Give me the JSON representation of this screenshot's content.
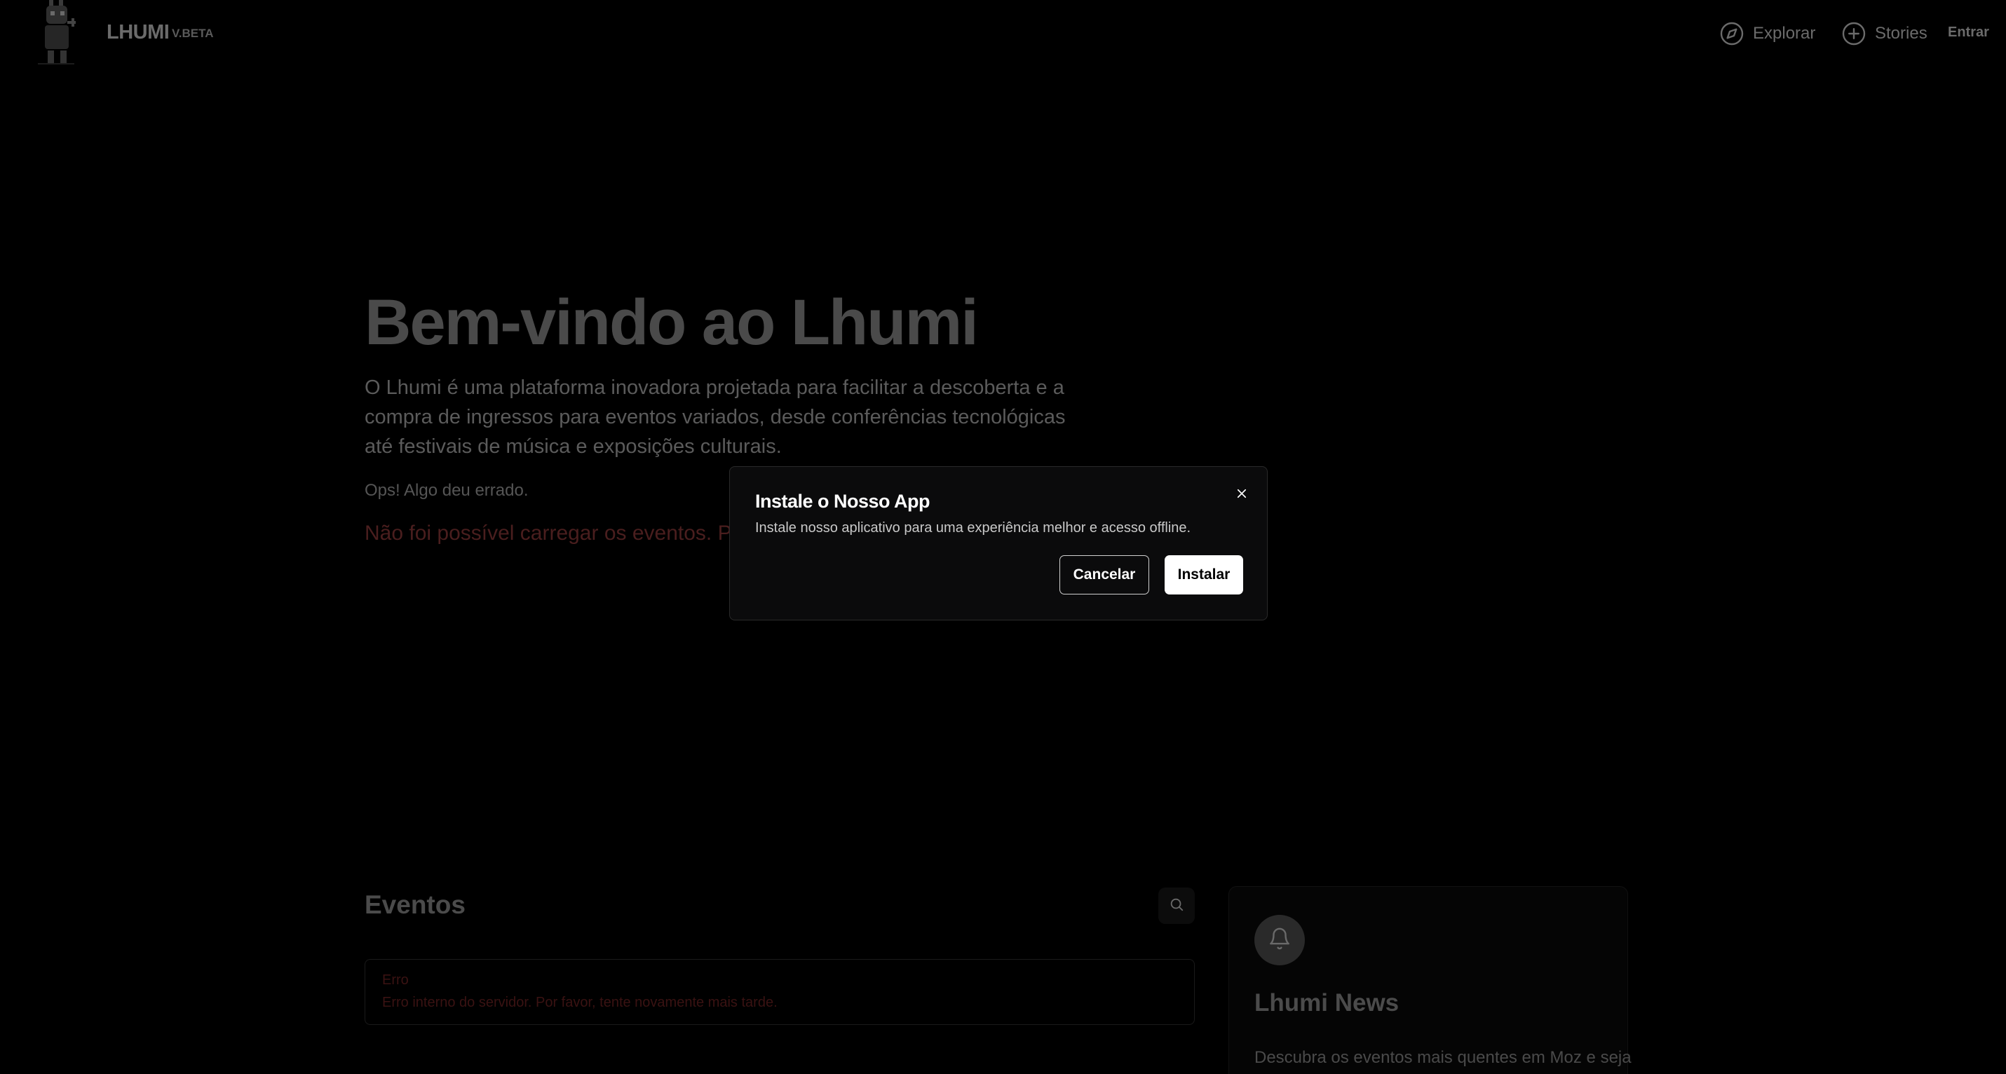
{
  "header": {
    "brand": "LHUMI",
    "badge": "V.BETA",
    "nav": [
      {
        "label": "Explorar",
        "icon": "compass-icon"
      },
      {
        "label": "Stories",
        "icon": "plus-circle-icon"
      }
    ],
    "login_label": "Entrar"
  },
  "hero": {
    "title": "Bem-vindo ao Lhumi",
    "description": "O Lhumi é uma plataforma inovadora projetada para facilitar a descoberta e a compra de ingressos para eventos variados, desde conferências tecnológicas até festivais de música e exposições culturais.",
    "error_title": "Ops! Algo deu errado.",
    "error_message": "Não foi possível carregar os eventos. Por fa"
  },
  "events": {
    "title": "Eventos",
    "search_icon": "search-icon",
    "error_title": "Erro",
    "error_message": "Erro interno do servidor. Por favor, tente novamente mais tarde."
  },
  "news": {
    "icon": "bell-icon",
    "title": "Lhumi News",
    "description": "Descubra os eventos mais quentes em Moz e seja"
  },
  "modal": {
    "title": "Instale o Nosso App",
    "description": "Instale nosso aplicativo para uma experiência melhor e acesso offline.",
    "cancel_label": "Cancelar",
    "install_label": "Instalar",
    "close_icon": "close-icon"
  },
  "colors": {
    "background": "#000000",
    "modal_bg": "#0b0b0c",
    "primary_button": "#ffffff",
    "error_text": "#3a1212"
  }
}
